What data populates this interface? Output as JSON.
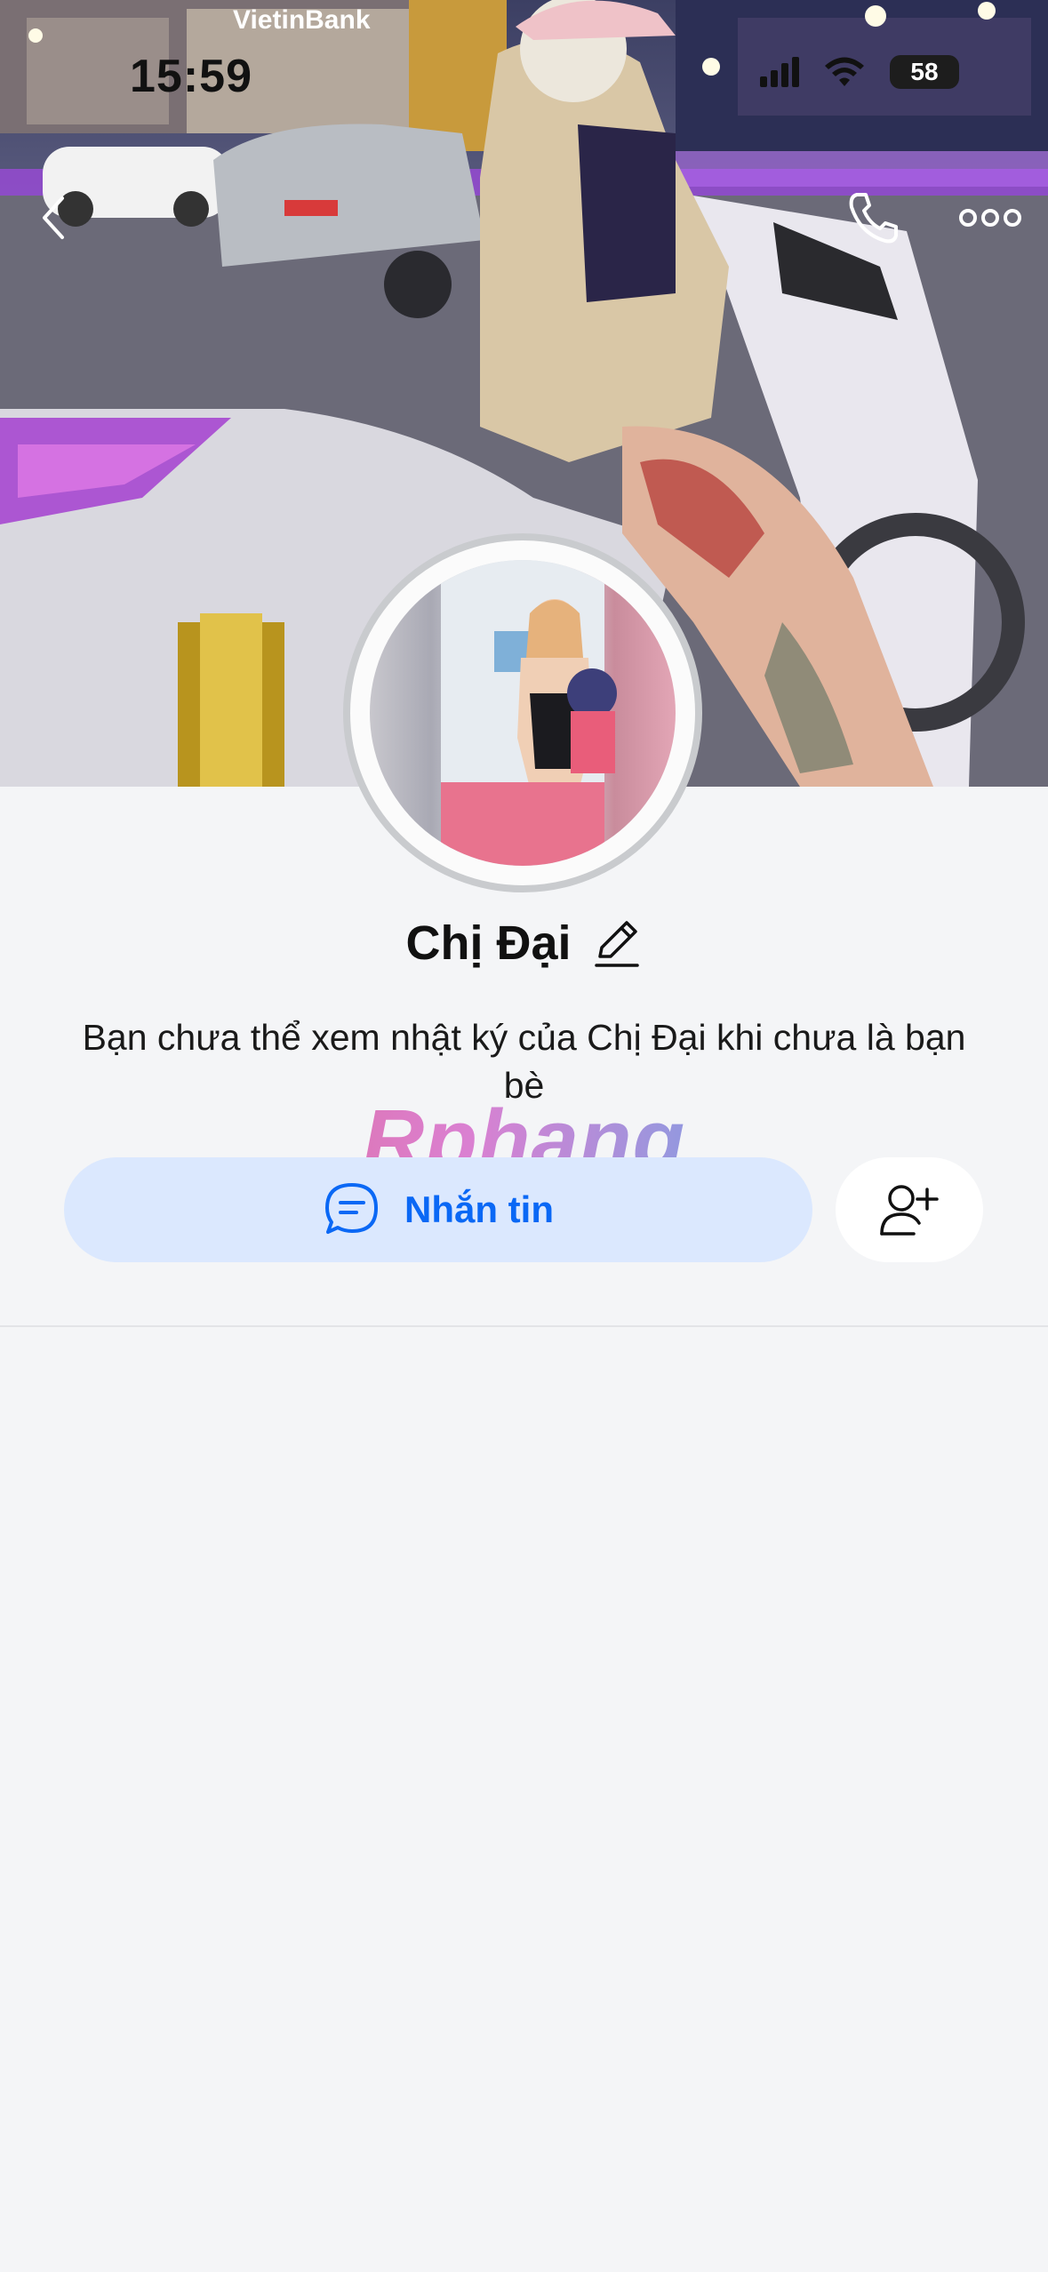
{
  "status_bar": {
    "time": "15:59",
    "battery_level": "58",
    "icons": [
      "cellular-signal-icon",
      "wifi-icon",
      "battery-icon"
    ]
  },
  "top_actions": {
    "back_icon": "chevron-left-icon",
    "call_icon": "phone-icon",
    "more_icon": "more-dots-icon"
  },
  "cover": {
    "sign_text": "VietinBank"
  },
  "profile": {
    "name": "Chị Đại",
    "edit_icon": "pencil-icon",
    "notice": "Bạn chưa thể xem nhật ký của Chị Đại khi chưa là bạn bè"
  },
  "watermark": {
    "text": "Rphang"
  },
  "actions": {
    "message_label": "Nhắn tin",
    "message_icon": "chat-bubble-icon",
    "add_friend_icon": "add-friend-icon"
  },
  "colors": {
    "accent": "#0a68f5",
    "message_button_bg": "#dbe8fe",
    "page_bg": "#f4f5f7"
  }
}
